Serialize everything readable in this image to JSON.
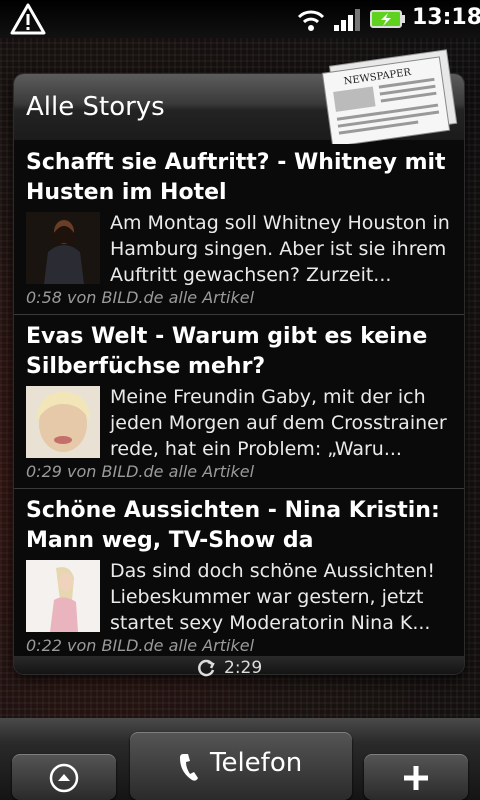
{
  "status_bar": {
    "time": "13:18",
    "icons": [
      "warning-icon",
      "wifi-icon",
      "signal-icon",
      "battery-charging-icon"
    ],
    "battery_color": "#5ed21e"
  },
  "widget": {
    "title": "Alle Storys",
    "header_icon": "newspaper-icon",
    "refresh_time": "2:29",
    "stories": [
      {
        "title": "Schafft sie Auftritt? - Whitney mit Husten im Hotel",
        "text": "Am Montag soll Whitney Houston in Hamburg singen. Aber ist sie ihrem Auftritt gewachsen? Zurzeit...",
        "meta": "0:58 von BILD.de alle Artikel"
      },
      {
        "title": "Evas Welt - Warum gibt es keine Silberfüchse mehr?",
        "text": "Meine Freundin Gaby, mit der ich jeden Morgen auf dem Crosstrainer rede, hat ein Problem: „Waru...",
        "meta": "0:29 von BILD.de alle Artikel"
      },
      {
        "title": "Schöne Aussichten - Nina Kristin: Mann weg, TV-Show da",
        "text": "Das sind doch schöne Aussichten! Liebeskummer war gestern, jetzt startet sexy Moderatorin Nina K...",
        "meta": "0:22 von BILD.de alle Artikel"
      }
    ]
  },
  "bottom_bar": {
    "phone_label": "Telefon",
    "left_icon": "app-drawer-up-icon",
    "right_icon": "add-icon"
  }
}
